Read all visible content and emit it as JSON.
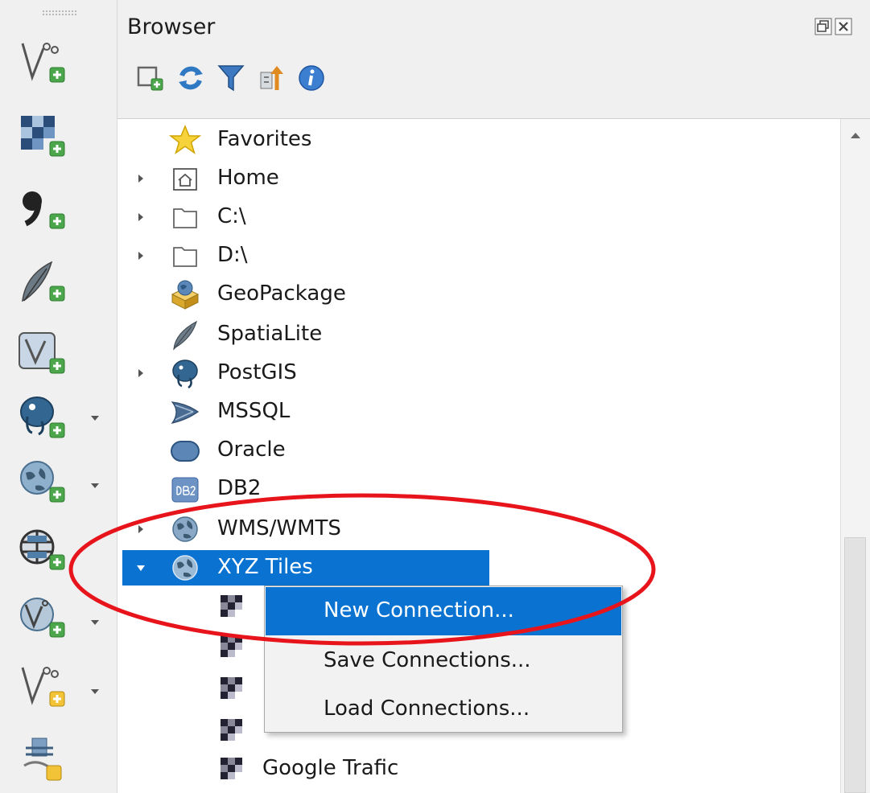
{
  "panel": {
    "title": "Browser",
    "toolbar": [
      {
        "icon": "add-selected-layers-icon"
      },
      {
        "icon": "refresh-icon"
      },
      {
        "icon": "filter-icon"
      },
      {
        "icon": "collapse-all-icon"
      },
      {
        "icon": "info-icon"
      }
    ],
    "header_buttons": [
      {
        "icon": "float-panel-icon"
      },
      {
        "icon": "close-panel-icon"
      }
    ]
  },
  "tree": {
    "items": [
      {
        "label": "Favorites",
        "icon": "star-icon",
        "expandable": false
      },
      {
        "label": "Home",
        "icon": "home-folder-icon",
        "expandable": true
      },
      {
        "label": "C:\\",
        "icon": "folder-icon",
        "expandable": true
      },
      {
        "label": "D:\\",
        "icon": "folder-icon",
        "expandable": true
      },
      {
        "label": "GeoPackage",
        "icon": "geopackage-icon",
        "expandable": false
      },
      {
        "label": "SpatiaLite",
        "icon": "feather-icon",
        "expandable": false
      },
      {
        "label": "PostGIS",
        "icon": "elephant-icon",
        "expandable": true
      },
      {
        "label": "MSSQL",
        "icon": "mssql-icon",
        "expandable": false
      },
      {
        "label": "Oracle",
        "icon": "oracle-icon",
        "expandable": false
      },
      {
        "label": "DB2",
        "icon": "db2-icon",
        "expandable": false
      },
      {
        "label": "WMS/WMTS",
        "icon": "globe-icon",
        "expandable": true
      },
      {
        "label": "XYZ Tiles",
        "icon": "globe-icon",
        "expandable": true,
        "expanded": true,
        "selected": true
      }
    ],
    "children": [
      {
        "label": "",
        "icon": "tile-icon"
      },
      {
        "label": "",
        "icon": "tile-icon"
      },
      {
        "label": "",
        "icon": "tile-icon"
      },
      {
        "label": "",
        "icon": "tile-icon"
      },
      {
        "label": "Google Trafic",
        "icon": "tile-icon"
      }
    ]
  },
  "context_menu": {
    "items": [
      {
        "label": "New Connection...",
        "highlighted": true
      },
      {
        "label": "Save Connections..."
      },
      {
        "label": "Load Connections..."
      }
    ]
  },
  "left_toolbar": {
    "tools": [
      {
        "icon": "new-vector-layer-icon"
      },
      {
        "icon": "add-raster-layer-icon"
      },
      {
        "icon": "add-delimited-text-layer-icon"
      },
      {
        "icon": "add-spatialite-layer-icon"
      },
      {
        "icon": "add-virtual-layer-icon"
      },
      {
        "icon": "add-postgis-layer-icon",
        "has_dropdown": true
      },
      {
        "icon": "add-wms-layer-icon",
        "has_dropdown": true
      },
      {
        "icon": "add-wcs-layer-icon"
      },
      {
        "icon": "add-wfs-layer-icon",
        "has_dropdown": true
      },
      {
        "icon": "new-geopackage-layer-icon",
        "has_dropdown": true
      },
      {
        "icon": "add-mesh-layer-icon"
      }
    ]
  },
  "colors": {
    "selection": "#0a73d1",
    "annotation": "#e8141b",
    "panel_bg": "#f0f0f0"
  }
}
